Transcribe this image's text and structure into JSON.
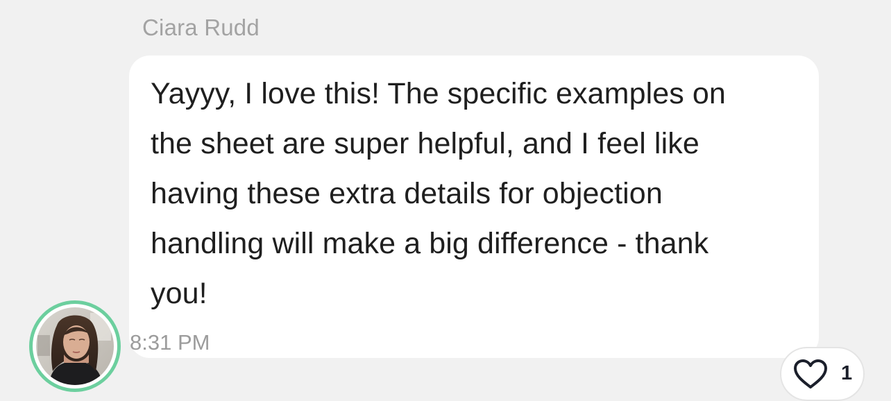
{
  "message": {
    "sender_name": "Ciara Rudd",
    "text": "Yayyy, I love this! The specific examples on\nthe sheet are super helpful, and I feel like\nhaving these extra details for objection\nhandling will make a big difference - thank\nyou!",
    "timestamp": "8:31 PM"
  },
  "reaction": {
    "icon": "heart-outline-icon",
    "count": "1"
  },
  "colors": {
    "avatar_ring": "#6ccf9e",
    "bubble": "#ffffff",
    "background": "#f1f1f1",
    "heart": "#1b1f2b"
  }
}
